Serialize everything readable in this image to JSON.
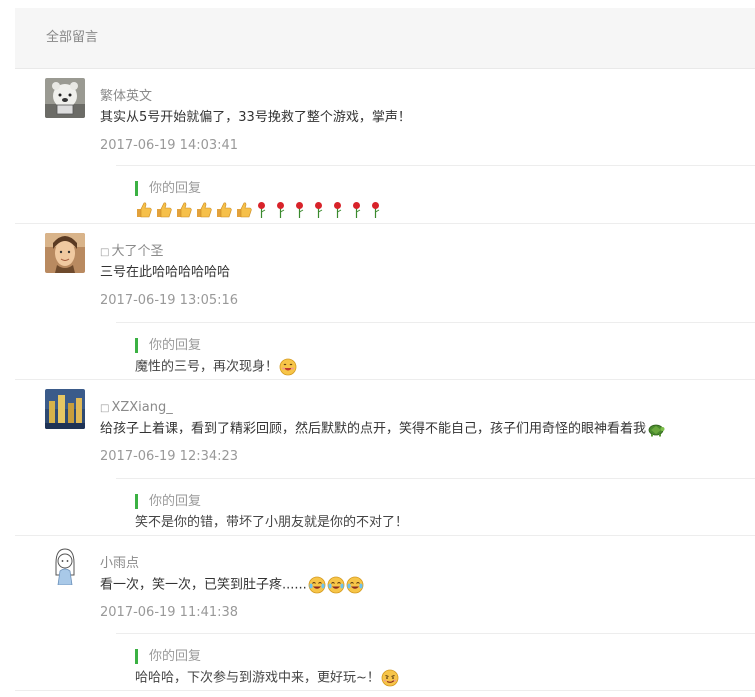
{
  "header": {
    "title": "全部留言"
  },
  "comments": [
    {
      "name": "繁体英文",
      "content": "其实从5号开始就偏了，33号挽救了整个游戏，掌声！",
      "time": "2017-06-19 14:03:41",
      "reply_label": "你的回复",
      "reply_text": "",
      "reply_emoji": [
        "thumbs-up",
        "thumbs-up",
        "thumbs-up",
        "thumbs-up",
        "thumbs-up",
        "thumbs-up",
        "rose",
        "rose",
        "rose",
        "rose",
        "rose",
        "rose",
        "rose"
      ]
    },
    {
      "name_icon": "□",
      "name": "大了个圣",
      "content": "三号在此哈哈哈哈哈哈",
      "time": "2017-06-19 13:05:16",
      "reply_label": "你的回复",
      "reply_text": "魔性的三号，再次现身！",
      "reply_emoji": [
        "grin"
      ]
    },
    {
      "name_icon": "□",
      "name": "XZXiang_",
      "content": "给孩子上着课，看到了精彩回顾，然后默默的点开，笑得不能自己，孩子们用奇怪的眼神看着我",
      "content_emoji": "turtle",
      "time": "2017-06-19 12:34:23",
      "reply_label": "你的回复",
      "reply_text": "笑不是你的错，带坏了小朋友就是你的不对了！"
    },
    {
      "name": "小雨点",
      "content": "看一次，笑一次，已笑到肚子疼......",
      "content_emoji": [
        "tears-of-joy",
        "tears-of-joy",
        "tears-of-joy"
      ],
      "time": "2017-06-19 11:41:38",
      "reply_label": "你的回复",
      "reply_text": "哈哈哈，下次参与到游戏中来，更好玩~！",
      "reply_emoji": [
        "smirk"
      ]
    }
  ]
}
